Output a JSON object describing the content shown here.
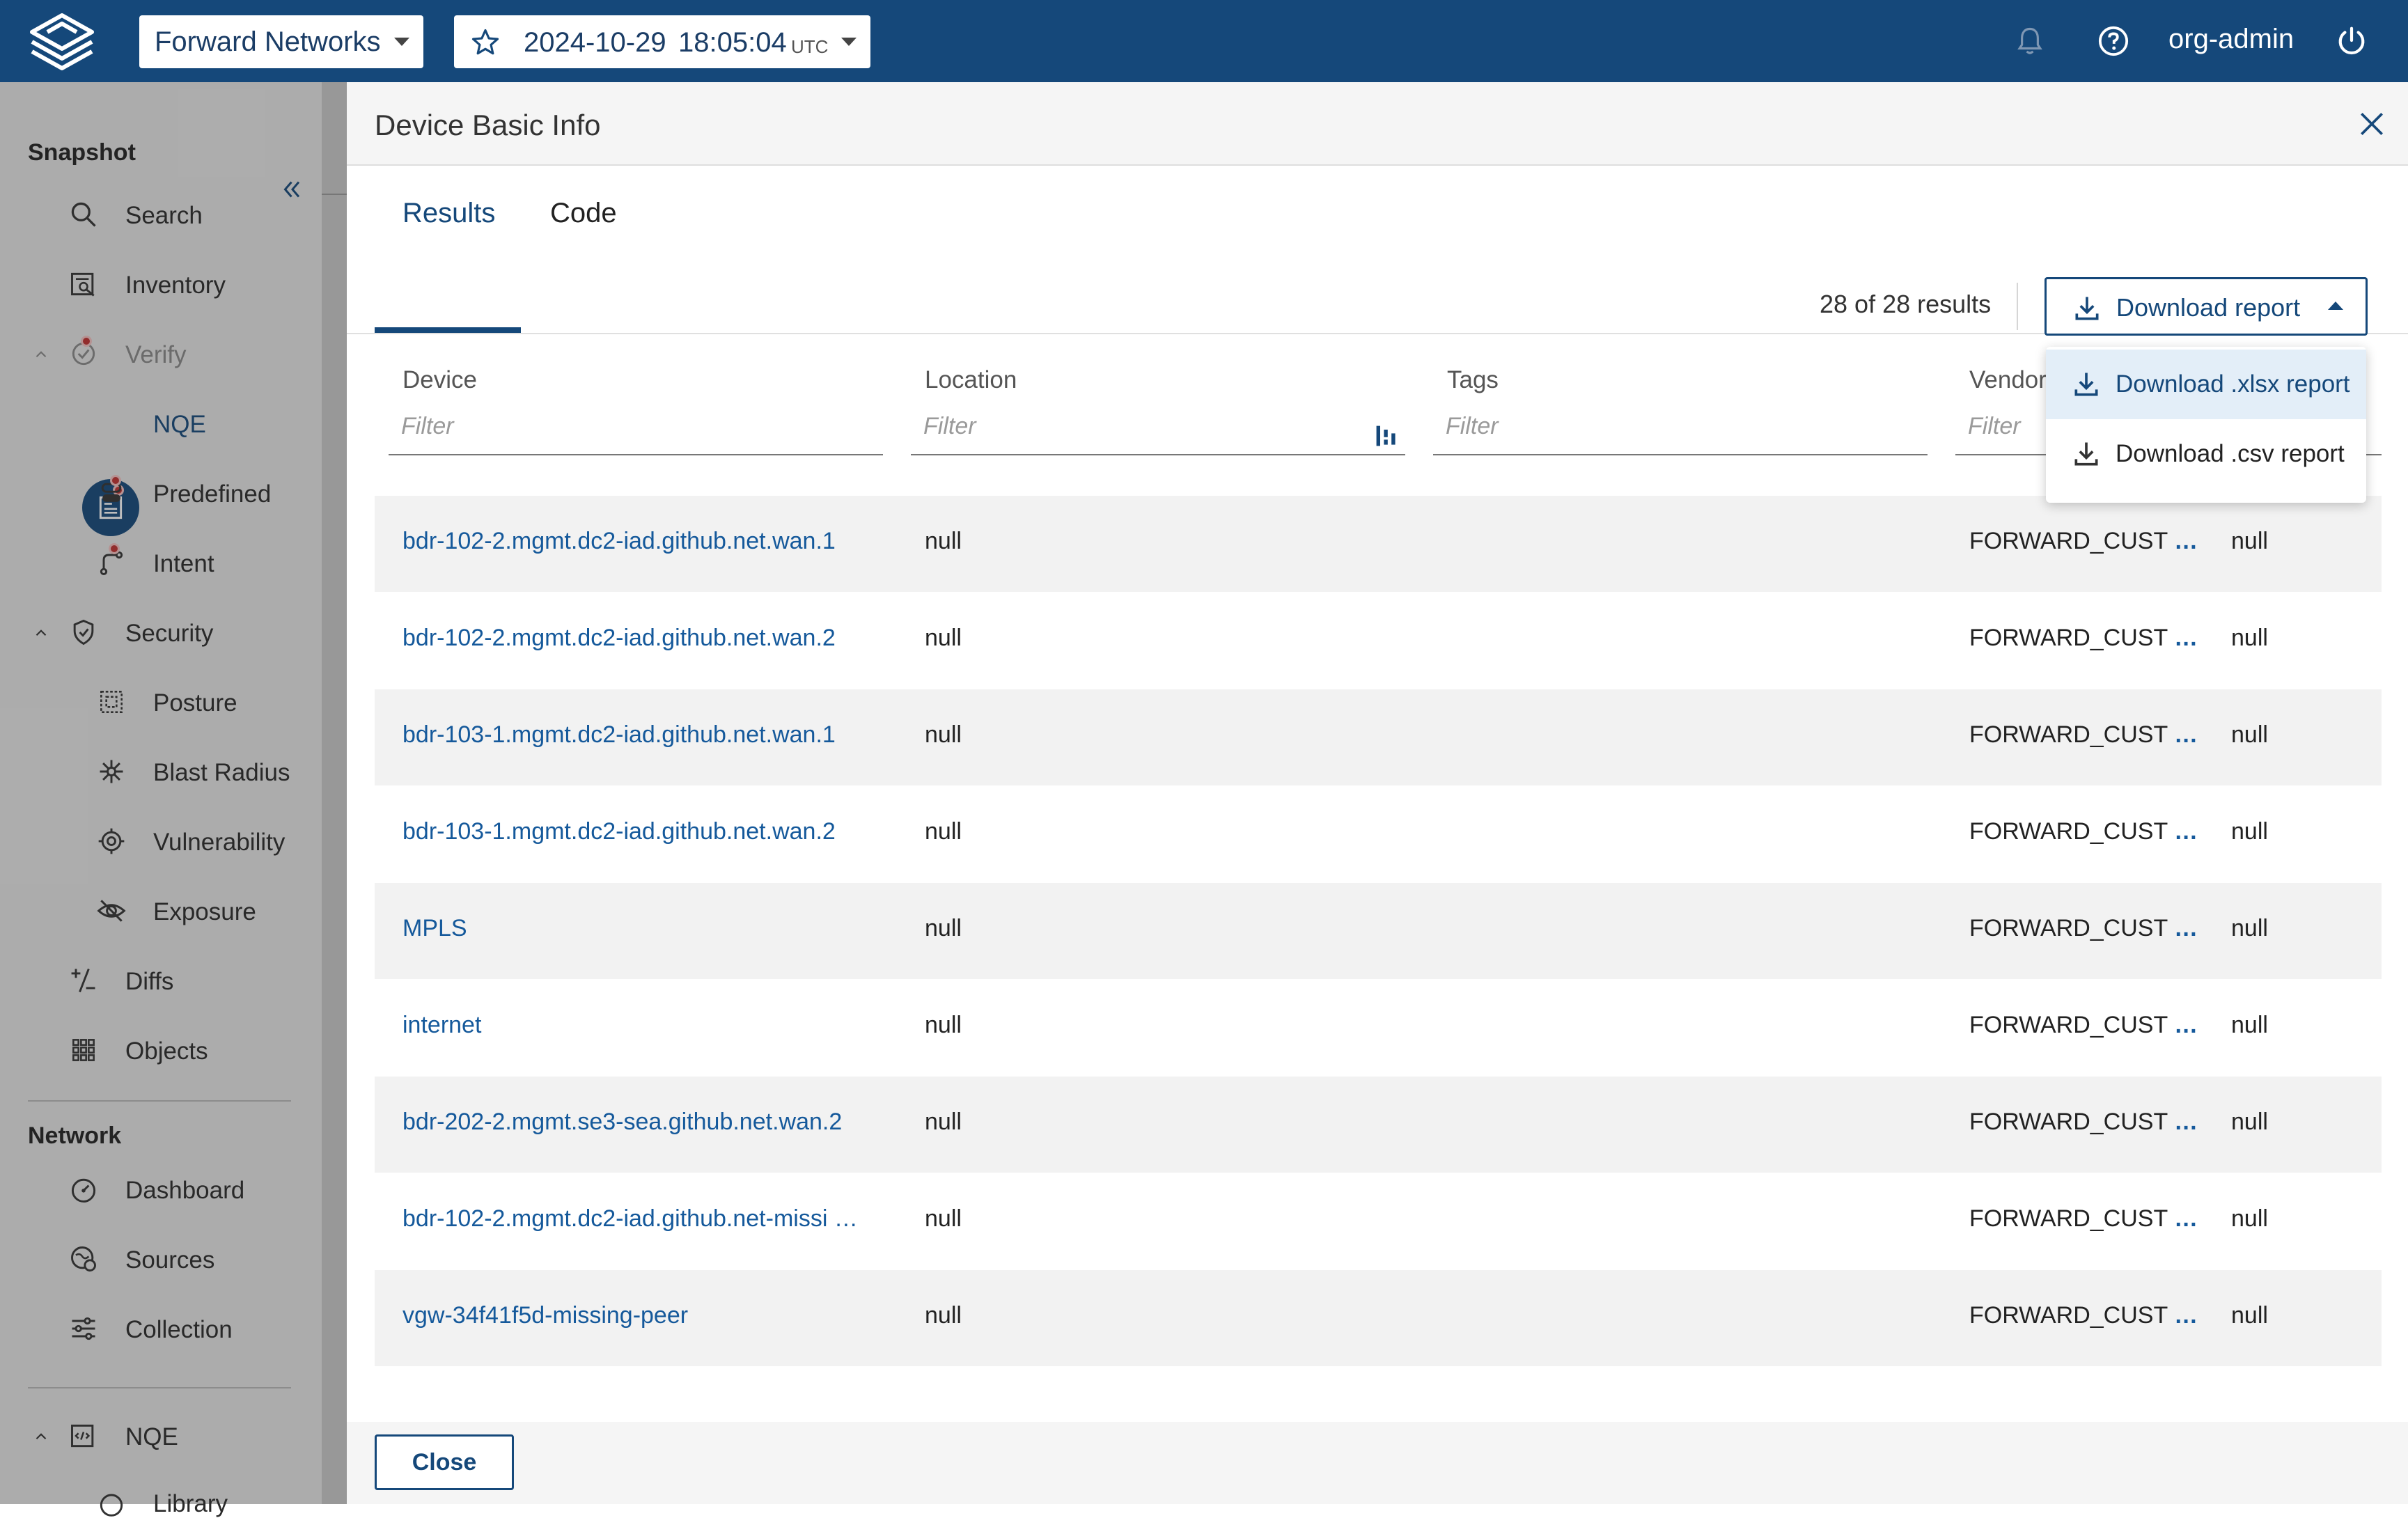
{
  "header": {
    "org_selector": "Forward Networks",
    "snapshot_date": "2024-10-29",
    "snapshot_time": "18:05:04",
    "snapshot_tz": "UTC",
    "user": "org-admin",
    "brand_color": "#15487a"
  },
  "sidebar": {
    "snapshot_heading": "Snapshot",
    "network_heading": "Network",
    "items": {
      "search": "Search",
      "inventory": "Inventory",
      "verify": "Verify",
      "nqe": "NQE",
      "predefined": "Predefined",
      "intent": "Intent",
      "security": "Security",
      "posture": "Posture",
      "blast_radius": "Blast Radius",
      "vulnerability": "Vulnerability",
      "exposure": "Exposure",
      "diffs": "Diffs",
      "objects": "Objects",
      "dashboard": "Dashboard",
      "sources": "Sources",
      "collection": "Collection",
      "nqe_section": "NQE",
      "library": "Library"
    }
  },
  "drawer": {
    "title": "Device Basic Info",
    "tabs": [
      "Results",
      "Code"
    ],
    "active_tab": "Results",
    "result_count": "28 of 28 results",
    "download_button": "Download report",
    "download_menu": [
      "Download .xlsx report",
      "Download .csv report"
    ],
    "columns": [
      "Device",
      "Location",
      "Tags",
      "Vendor"
    ],
    "filter_placeholder": "Filter",
    "rows": [
      {
        "device": "bdr-102-2.mgmt.dc2-iad.github.net.wan.1",
        "location": "null",
        "vendor": "FORWARD_CUST",
        "last": "null"
      },
      {
        "device": "bdr-102-2.mgmt.dc2-iad.github.net.wan.2",
        "location": "null",
        "vendor": "FORWARD_CUST",
        "last": "null"
      },
      {
        "device": "bdr-103-1.mgmt.dc2-iad.github.net.wan.1",
        "location": "null",
        "vendor": "FORWARD_CUST",
        "last": "null"
      },
      {
        "device": "bdr-103-1.mgmt.dc2-iad.github.net.wan.2",
        "location": "null",
        "vendor": "FORWARD_CUST",
        "last": "null"
      },
      {
        "device": "MPLS",
        "location": "null",
        "vendor": "FORWARD_CUST",
        "last": "null"
      },
      {
        "device": "internet",
        "location": "null",
        "vendor": "FORWARD_CUST",
        "last": "null"
      },
      {
        "device": "bdr-202-2.mgmt.se3-sea.github.net.wan.2",
        "location": "null",
        "vendor": "FORWARD_CUST",
        "last": "null"
      },
      {
        "device": "bdr-102-2.mgmt.dc2-iad.github.net-missi …",
        "location": "null",
        "vendor": "FORWARD_CUST",
        "last": "null"
      },
      {
        "device": "vgw-34f41f5d-missing-peer",
        "location": "null",
        "vendor": "FORWARD_CUST",
        "last": "null"
      }
    ],
    "ellipsis": "…",
    "close_button": "Close"
  }
}
